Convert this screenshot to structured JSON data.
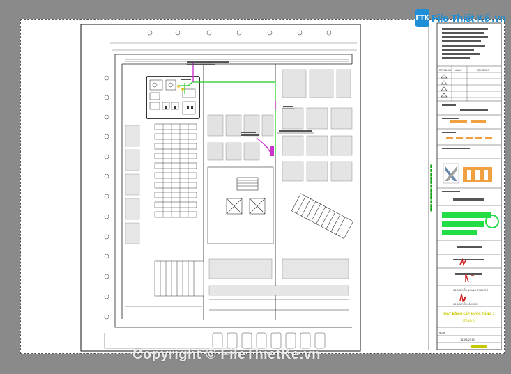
{
  "logo": {
    "box": "FTK",
    "text": "File Thiết Kế .vn"
  },
  "watermark": "Copyright © FileThietKe.vn",
  "colors": {
    "page_bg": "#8a8a8a",
    "pipe_green": "#22cc22",
    "pipe_magenta": "#cc33cc",
    "accent_red": "#d01818",
    "stamp_green": "#22dd44",
    "title_yellow": "#d8d800",
    "orange_block": "#f0a040"
  },
  "titleblock": {
    "revision_header": "REVISION",
    "date_header": "NGÀY",
    "content_header": "NỘI DUNG",
    "signatures": [
      "PHÓ TRƯỞNG PHÒNG",
      "KS. NGUYỄN QUANG THANH TÚ",
      "KS. NGUYỄN LÂM SƠN"
    ],
    "sheet_title": "MẶT BẰNG CẤP NƯỚC TẦNG 1",
    "sheet_subtitle": "(TẦNG 1)",
    "date_label": "NGÀY",
    "date_value": "11/06/2013"
  },
  "icons": [
    "revision-triangle-icon",
    "company-logo-icon",
    "stamp-icon"
  ]
}
